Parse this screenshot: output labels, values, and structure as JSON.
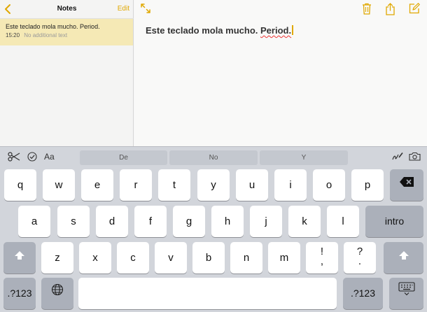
{
  "sidebar": {
    "back_icon": "chevron-left-icon",
    "title": "Notes",
    "edit_label": "Edit",
    "notes": [
      {
        "title": "Este teclado mola mucho. Period.",
        "time": "15:20",
        "preview": "No additional text"
      }
    ]
  },
  "editor": {
    "toolbar_icons": [
      "expand-icon",
      "trash-icon",
      "share-icon",
      "compose-icon"
    ],
    "body_text": "Este teclado mola mucho. ",
    "misspelled_word": "Period."
  },
  "keyboard": {
    "shortcut_icons": [
      "scissors-icon",
      "checkmark-circle-icon",
      "text-format-icon",
      "handwriting-icon",
      "camera-icon"
    ],
    "format_label": "Aa",
    "suggestions": [
      "De",
      "No",
      "Y"
    ],
    "row1": [
      "q",
      "w",
      "e",
      "r",
      "t",
      "y",
      "u",
      "i",
      "o",
      "p"
    ],
    "row2": [
      "a",
      "s",
      "d",
      "f",
      "g",
      "h",
      "j",
      "k",
      "l"
    ],
    "row3": [
      "z",
      "x",
      "c",
      "v",
      "b",
      "n",
      "m"
    ],
    "punct_1": {
      "top": "!",
      "bottom": ","
    },
    "punct_2": {
      "top": "?",
      "bottom": "."
    },
    "return_label": "intro",
    "numbers_label": ".?123",
    "numbers_label_right": ".?123",
    "backspace_icon": "backspace-icon",
    "shift_icon": "shift-icon",
    "globe_icon": "globe-icon",
    "dismiss_icon": "keyboard-dismiss-icon"
  },
  "colors": {
    "accent": "#e0a800",
    "selected_note": "#f5e9b5",
    "keyboard_bg": "#d2d5db",
    "dark_key": "#abb0ba",
    "misspelling": "#e33333"
  }
}
